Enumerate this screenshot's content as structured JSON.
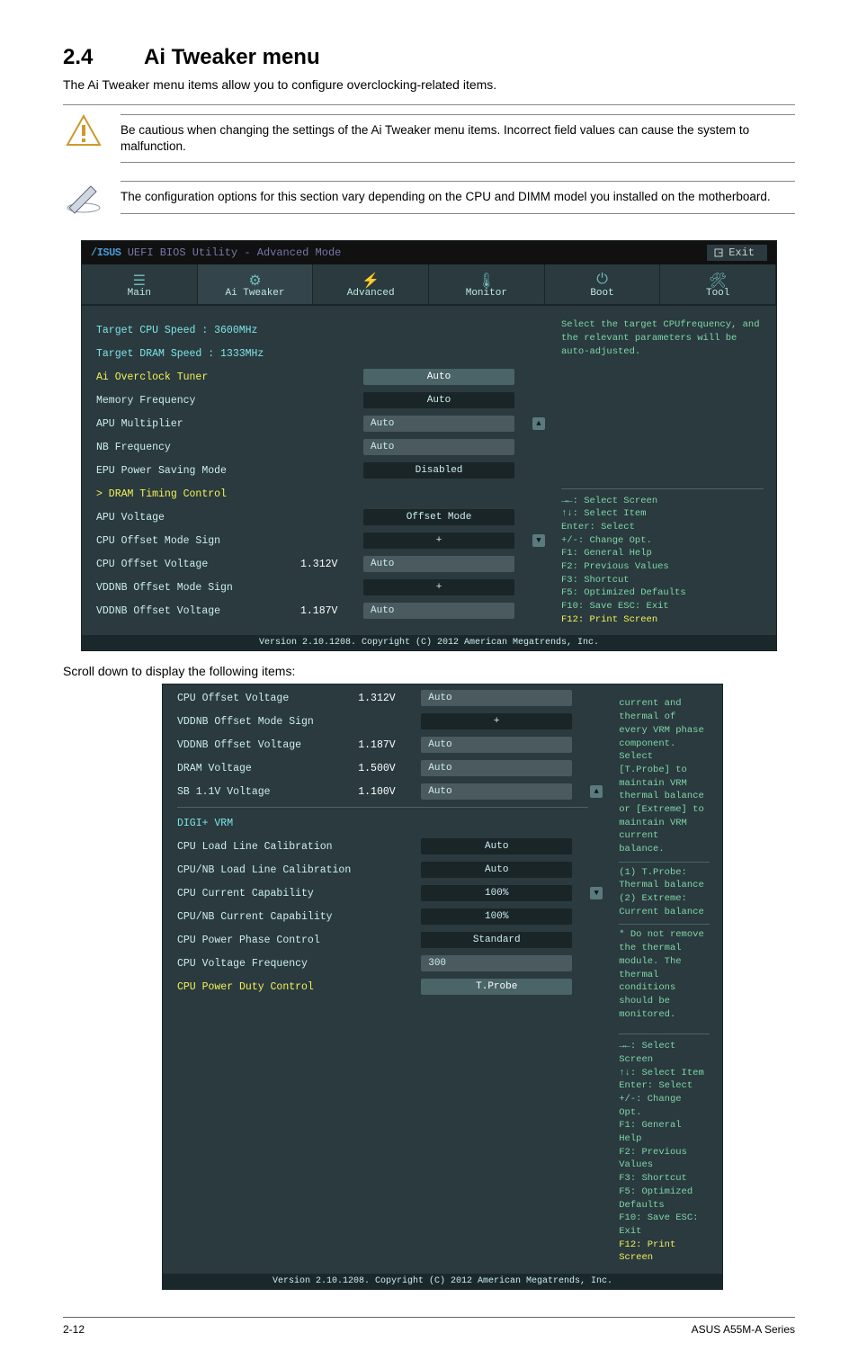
{
  "heading_num": "2.4",
  "heading_text": "Ai Tweaker menu",
  "intro": "The Ai Tweaker menu items allow you to configure overclocking-related items.",
  "note1": "Be cautious when changing the settings of the Ai Tweaker menu items. Incorrect field values can cause the system to malfunction.",
  "note2": "The configuration options for this section vary depending on the CPU and DIMM model you installed on the motherboard.",
  "bios_title_brand": "/ISUS",
  "bios_title_rest": " UEFI BIOS Utility - Advanced Mode",
  "exit_label": "Exit",
  "tabs": {
    "main": "Main",
    "ai_tweaker": "Ai Tweaker",
    "advanced": "Advanced",
    "monitor": "Monitor",
    "boot": "Boot",
    "tool": "Tool"
  },
  "screen1": {
    "target_cpu": "Target CPU Speed : 3600MHz",
    "target_dram": "Target DRAM Speed : 1333MHz",
    "rows": [
      {
        "label": "Ai Overclock Tuner",
        "val": "Auto",
        "cls": "yellow",
        "box": "highlight"
      },
      {
        "label": "Memory Frequency",
        "val": "Auto"
      },
      {
        "label": "APU Multiplier",
        "val": "Auto",
        "box": "input",
        "arrow": "up"
      },
      {
        "label": "NB Frequency",
        "val": "Auto",
        "box": "input"
      },
      {
        "label": "EPU Power Saving Mode",
        "val": "Disabled"
      },
      {
        "label": "> DRAM Timing Control",
        "cls": "yellow",
        "noval": true
      },
      {
        "label": "APU Voltage",
        "val": "Offset Mode"
      },
      {
        "label": "  CPU Offset Mode Sign",
        "val": "+",
        "arrow": "down"
      },
      {
        "label": "  CPU Offset Voltage",
        "mid": "1.312V",
        "val": "Auto",
        "box": "input"
      },
      {
        "label": "  VDDNB Offset Mode Sign",
        "val": "+"
      },
      {
        "label": "  VDDNB Offset Voltage",
        "mid": "1.187V",
        "val": "Auto",
        "box": "input"
      }
    ],
    "help": "Select the target CPUfrequency, and the relevant parameters will be auto-adjusted."
  },
  "keys": {
    "l1": "→←: Select Screen",
    "l2": "↑↓: Select Item",
    "l3": "Enter: Select",
    "l4": "+/-: Change Opt.",
    "l5": "F1: General Help",
    "l6": "F2: Previous Values",
    "l7": "F3: Shortcut",
    "l8": "F5: Optimized Defaults",
    "l9": "F10: Save  ESC: Exit",
    "l10": "F12: Print Screen"
  },
  "copyright": "Version 2.10.1208. Copyright (C) 2012 American Megatrends, Inc.",
  "scroll_note": "Scroll down to display the following items:",
  "screen2": {
    "rows": [
      {
        "label": "  CPU Offset Voltage",
        "mid": "1.312V",
        "val": "Auto",
        "box": "input"
      },
      {
        "label": "  VDDNB Offset Mode Sign",
        "val": "+"
      },
      {
        "label": "  VDDNB Offset Voltage",
        "mid": "1.187V",
        "val": "Auto",
        "box": "input"
      },
      {
        "label": "DRAM Voltage",
        "mid": "1.500V",
        "val": "Auto",
        "box": "input"
      },
      {
        "label": "SB 1.1V Voltage",
        "mid": "1.100V",
        "val": "Auto",
        "box": "input",
        "arrow": "up"
      }
    ],
    "digi_header": "DIGI+ VRM",
    "rows2": [
      {
        "label": "CPU Load Line Calibration",
        "val": "Auto"
      },
      {
        "label": "CPU/NB Load Line Calibration",
        "val": "Auto"
      },
      {
        "label": "CPU Current Capability",
        "val": "100%",
        "arrow": "down"
      },
      {
        "label": "CPU/NB Current Capability",
        "val": "100%"
      },
      {
        "label": "CPU Power Phase Control",
        "val": "Standard"
      },
      {
        "label": "CPU Voltage Frequency",
        "val": "300",
        "box": "input"
      },
      {
        "label": "CPU Power Duty Control",
        "val": "T.Probe",
        "cls": "yellow",
        "box": "highlight"
      }
    ],
    "help1": "current and thermal of every VRM phase component. Select [T.Probe] to maintain VRM thermal balance or [Extreme] to maintain VRM current balance.",
    "help2": "(1) T.Probe: Thermal balance\n(2) Extreme: Current balance",
    "help3": "* Do not remove the thermal module. The thermal conditions should be monitored."
  },
  "footer_left": "2-12",
  "footer_right": "ASUS A55M-A Series"
}
